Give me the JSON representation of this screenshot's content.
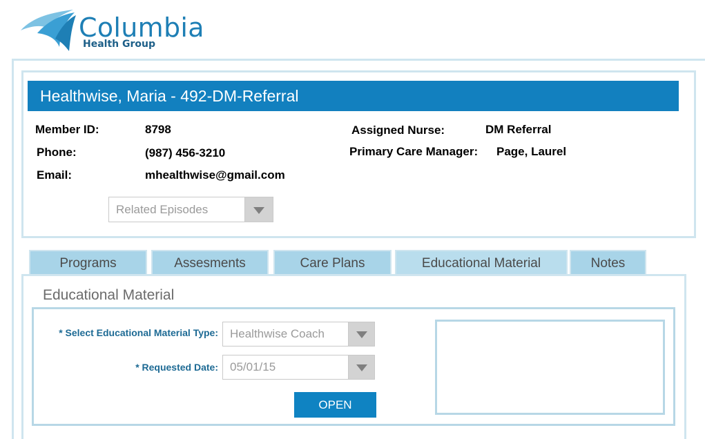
{
  "brand": {
    "name": "Columbia",
    "subtitle": "Health Group",
    "color": "#1e7fb5"
  },
  "member": {
    "title": "Healthwise, Maria - 492-DM-Referral",
    "fields": {
      "member_id_label": "Member ID:",
      "member_id_value": "8798",
      "phone_label": "Phone:",
      "phone_value": "(987) 456-3210",
      "email_label": "Email:",
      "email_value": "mhealthwise@gmail.com",
      "nurse_label": "Assigned Nurse:",
      "nurse_value": "DM Referral",
      "pcm_label": "Primary Care Manager:",
      "pcm_value": "Page, Laurel"
    },
    "related_episodes": {
      "placeholder": "Related Episodes",
      "icon": "chevron-down-icon"
    }
  },
  "tabs": [
    {
      "label": "Programs",
      "active": false
    },
    {
      "label": "Assesments",
      "active": false
    },
    {
      "label": "Care Plans",
      "active": false
    },
    {
      "label": "Educational Material",
      "active": true
    },
    {
      "label": "Notes",
      "active": false
    }
  ],
  "educational": {
    "section_title": "Educational Material",
    "type_label": "* Select Educational Material Type:",
    "type_value": "Healthwise Coach",
    "date_label": "* Requested Date:",
    "date_value": "05/01/15",
    "open_button": "OPEN"
  },
  "colors": {
    "title_bar": "#1280bf",
    "tab_bg": "#a8d4e8",
    "border": "#cfe5ef",
    "button": "#0f83c2",
    "form_label": "#1d6a94"
  }
}
